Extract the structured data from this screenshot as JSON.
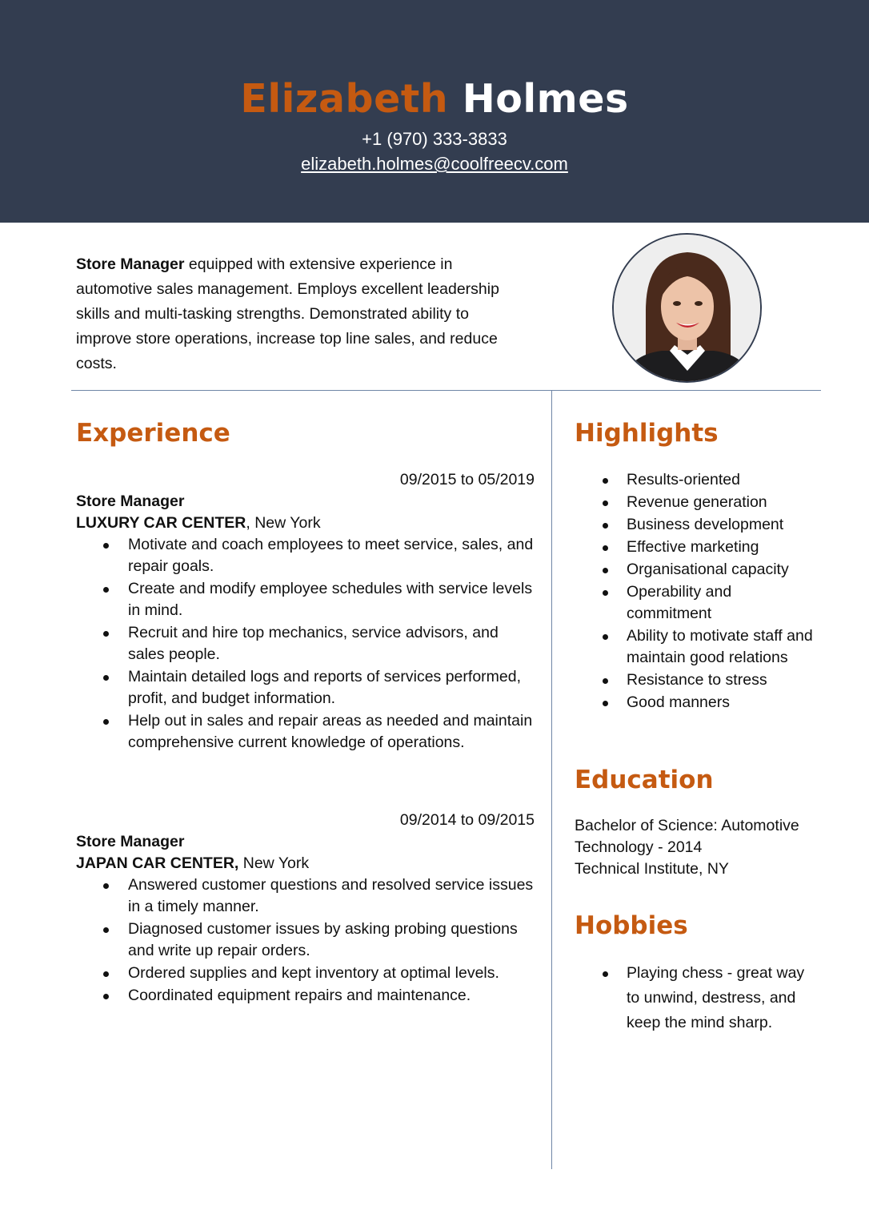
{
  "header": {
    "first_name": "Elizabeth",
    "last_name": "Holmes",
    "phone": "+1 (970) 333-3833",
    "email": "elizabeth.holmes@coolfreecv.com"
  },
  "summary": {
    "role": "Store Manager",
    "text": " equipped with extensive experience in automotive sales management. Employs excellent leadership skills and multi-tasking strengths. Demonstrated ability to improve store operations, increase top line sales, and reduce costs."
  },
  "experience": {
    "heading": "Experience",
    "jobs": [
      {
        "dates": "09/2015 to 05/2019",
        "title": "Store Manager",
        "company": "LUXURY CAR CENTER",
        "location": ", New York",
        "bullets": [
          "Motivate and coach employees to meet service, sales, and repair goals.",
          "Create and modify employee schedules with service levels in mind.",
          "Recruit and hire top mechanics, service advisors, and sales people.",
          "Maintain detailed logs and reports of services performed, profit, and budget information.",
          "Help out in sales and repair areas as needed and maintain comprehensive current knowledge of operations."
        ]
      },
      {
        "dates": "09/2014 to 09/2015",
        "title": "Store Manager",
        "company": "JAPAN CAR CENTER,",
        "location": " New York",
        "bullets": [
          "Answered customer questions and resolved service issues in a timely manner.",
          "Diagnosed customer issues by asking probing questions and write up repair orders.",
          "Ordered supplies and kept inventory at optimal levels.",
          "Coordinated equipment repairs and maintenance."
        ]
      }
    ]
  },
  "highlights": {
    "heading": "Highlights",
    "items": [
      "Results-oriented",
      "Revenue generation",
      "Business development",
      "Effective marketing",
      "Organisational capacity",
      "Operability and commitment",
      "Ability to motivate staff and maintain good relations",
      "Resistance to stress",
      "Good manners"
    ]
  },
  "education": {
    "heading": "Education",
    "degree": "Bachelor of Science: Automotive Technology - 2014",
    "school": "Technical Institute, NY"
  },
  "hobbies": {
    "heading": "Hobbies",
    "items": [
      "Playing chess - great way to unwind, destress, and keep the mind sharp."
    ]
  },
  "colors": {
    "header_bg": "#333d50",
    "accent": "#c55a11",
    "rule": "#6f86a6"
  }
}
